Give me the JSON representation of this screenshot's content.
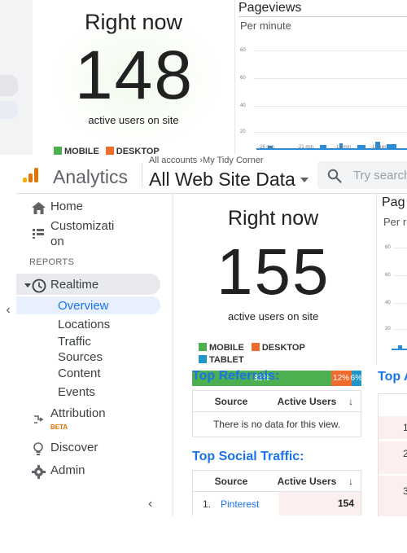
{
  "background_view": {
    "title": "Right now",
    "active_count": "148",
    "active_label": "active users on site",
    "legend": [
      "MOBILE",
      "DESKTOP"
    ],
    "pageviews_title": "Pageviews",
    "pageviews_sub": "Per minute",
    "y_ticks": [
      "60",
      "60",
      "40",
      "20"
    ],
    "x_ticks": [
      "-26 min",
      "-21 min",
      "-16 min",
      "-11 min"
    ]
  },
  "header": {
    "app_name": "Analytics",
    "accounts_crumb": "All accounts ›My Tidy Corner",
    "property": "All Web Site Data",
    "search_placeholder": "Try search"
  },
  "sidebar": {
    "home": "Home",
    "customization": "Customizati\non",
    "reports_heading": "REPORTS",
    "realtime": "Realtime",
    "sub_items": [
      "Overview",
      "Locations",
      "Traffic Sources",
      "Content",
      "Events"
    ],
    "attribution": "Attribution",
    "attribution_badge": "BETA",
    "discover": "Discover",
    "admin": "Admin"
  },
  "realtime": {
    "title": "Right now",
    "active_count": "155",
    "active_label": "active users on site",
    "legend": [
      "MOBILE",
      "DESKTOP",
      "TABLET"
    ],
    "device_split": {
      "mobile": "82%",
      "desktop": "12%",
      "tablet": "6%"
    },
    "device_split_values": {
      "mobile": 82,
      "desktop": 12,
      "tablet": 6
    },
    "top_referrals": {
      "title": "Top Referrals:",
      "col_source": "Source",
      "col_active": "Active Users",
      "empty": "There is no data for this view."
    },
    "top_social": {
      "title": "Top Social Traffic:",
      "col_source": "Source",
      "col_active": "Active Users",
      "rows": [
        {
          "rank": "1.",
          "source": "Pinterest",
          "users": "154"
        }
      ]
    },
    "pageviews_title": "Pag",
    "pageviews_sub": "Per r",
    "y_ticks": [
      "60",
      "60",
      "40",
      "20"
    ],
    "top_partial_title": "Top A",
    "right_table_ranks": [
      "1",
      "2",
      "3"
    ]
  },
  "colors": {
    "mobile": "#4caf50",
    "desktop": "#ef6c2c",
    "tablet": "#2196c8",
    "link": "#1a73e8"
  }
}
